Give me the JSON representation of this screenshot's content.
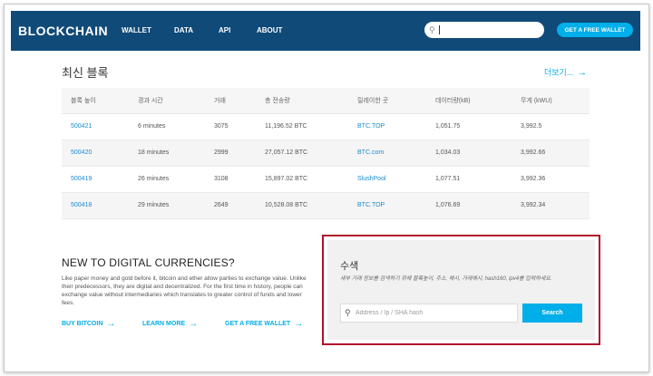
{
  "header": {
    "logo": "BLOCKCHAIN",
    "nav": [
      "WALLET",
      "DATA",
      "API",
      "ABOUT"
    ],
    "cta": "GET A FREE WALLET",
    "brand_color": "#104a78",
    "accent_color": "#00aee9"
  },
  "blocks": {
    "title": "최신 블록",
    "more_label": "더보기...",
    "columns": [
      "블록 높이",
      "경과 시간",
      "거래",
      "총 전송량",
      "릴레이한 곳",
      "데이터량(kB)",
      "무게 (kWU)"
    ],
    "rows": [
      [
        "500421",
        "6 minutes",
        "3075",
        "11,196.52 BTC",
        "BTC.TOP",
        "1,051.75",
        "3,992.5"
      ],
      [
        "500420",
        "18 minutes",
        "2999",
        "27,057.12 BTC",
        "BTC.com",
        "1,034.03",
        "3,992.66"
      ],
      [
        "500419",
        "26 minutes",
        "3108",
        "15,897.02 BTC",
        "SlushPool",
        "1,077.51",
        "3,992.36"
      ],
      [
        "500418",
        "29 minutes",
        "2649",
        "10,528.08 BTC",
        "BTC.TOP",
        "1,076.69",
        "3,992.34"
      ]
    ]
  },
  "intro": {
    "title": "NEW TO DIGITAL CURRENCIES?",
    "description": "Like paper money and gold before it, bitcoin and ether allow parties to exchange value. Unlike their predecessors, they are digital and decentralized. For the first time in history, people can exchange value without intermediaries which translates to greater control of funds and lower fees.",
    "links": [
      "BUY BITCOIN",
      "LEARN MORE",
      "GET A FREE WALLET"
    ]
  },
  "search": {
    "title": "수색",
    "description": "세부 거래 정보를 검색하기 위해 블록높이, 주소, 해시, 거래해시, hash160, ipv4를 입력하세요.",
    "placeholder": "Address / Ip / SHA hash",
    "button": "Search",
    "highlight_color": "#b0112b"
  }
}
